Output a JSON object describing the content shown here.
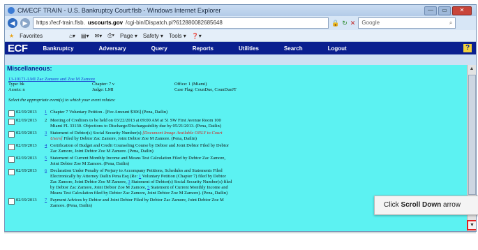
{
  "window": {
    "title": "CM/ECF TRAIN - U.S. Bankruptcy Court:flsb - Windows Internet Explorer",
    "buttons": {
      "minimize": "—",
      "maximize": "▭",
      "close": "✕"
    }
  },
  "addressbar": {
    "url_prefix": "https://ecf-train.flsb.",
    "url_domain": "uscourts.gov",
    "url_path": "/cgi-bin/Dispatch.pl?612880082685648",
    "search_placeholder": "Google",
    "icons": [
      "back-icon",
      "forward-icon",
      "lock-icon",
      "refresh-icon",
      "stop-icon",
      "search-icon"
    ]
  },
  "favbar": {
    "favorites": "Favorites",
    "page": "Page ▾",
    "safety": "Safety ▾",
    "tools": "Tools ▾",
    "help": "❓▾"
  },
  "ecf": {
    "logo": "ECF",
    "menu": [
      "Bankruptcy",
      "Adversary",
      "Query",
      "Reports",
      "Utilities",
      "Search",
      "Logout"
    ],
    "help_label": "?"
  },
  "page": {
    "section_title": "Miscellaneous:",
    "case_link": "13-10171-LMI Zac Zamore and Zoe M Zamore",
    "case_info": {
      "type": "Type: bk",
      "chapter": "Chapter: 7 v",
      "office": "Office: 1 (Miami)",
      "assets": "Assets: n",
      "judge": "Judge: LMI",
      "case_flag": "Case Flag: CounDue, CounDueJT"
    },
    "instructions": "Select the appropriate event(s) to which your event relates:",
    "entries": [
      {
        "date": "02/19/2013",
        "num": "1",
        "linked": true,
        "text": "Chapter 7 Voluntary Petition . [Fee Amount $306] (Pena, Dailin)"
      },
      {
        "date": "02/19/2013",
        "num": "2",
        "linked": false,
        "text": "Meeting of Creditors to be held on 03/22/2013 at 09:00 AM at 51 SW First Avenue Room 100 Miami FL 33130. Objections to Discharge/Dischargeability due by 05/21/2013. (Pena, Dailin)"
      },
      {
        "date": "02/19/2013",
        "num": "3",
        "linked": true,
        "text_a": "Statement of Debtor(s) Social Security Number(s) ",
        "text_red": "[Document Image Available ONLY to Court Users]",
        "text_b": " Filed by Debtor Zac Zamore, Joint Debtor Zoe M Zamore. (Pena, Dailin)"
      },
      {
        "date": "02/19/2013",
        "num": "4",
        "linked": true,
        "text": "Certification of Budget and Credit Counseling Course by Debtor and Joint Debtor Filed by Debtor Zac Zamore, Joint Debtor Zoe M Zamore. (Pena, Dailin)"
      },
      {
        "date": "02/19/2013",
        "num": "5",
        "linked": true,
        "text": "Statement of Current Monthly Income and Means Test Calculation Filed by Debtor Zac Zamore, Joint Debtor Zoe M Zamore. (Pena, Dailin)"
      },
      {
        "date": "02/19/2013",
        "num": "6",
        "linked": true,
        "text_a": "Declaration Under Penalty of Perjury to Accompany Petitions, Schedules and Statements Filed Electronically by Attorney Dailin Pena Esq (Re: ",
        "link1": "1",
        "text_b": " Voluntary Petition (Chapter 7) filed by Debtor Zac Zamore, Joint Debtor Zoe M Zamore, ",
        "link2": "3",
        "text_c": " Statement of Debtor(s) Social Security Number(s) filed by Debtor Zac Zamore, Joint Debtor Zoe M Zamore, ",
        "link3": "5",
        "text_d": " Statement of Current Monthly Income and Means Test Calculation filed by Debtor Zac Zamore, Joint Debtor Zoe M Zamore). (Pena, Dailin)"
      },
      {
        "date": "02/19/2013",
        "num": "7",
        "linked": true,
        "text": "Payment Advices by Debtor and Joint Debtor Filed by Debtor Zac Zamore, Joint Debtor Zoe M Zamore. (Pena, Dailin)"
      }
    ]
  },
  "tooltip": {
    "prefix": "Click ",
    "bold": "Scroll Down",
    "suffix": " arrow"
  },
  "colors": {
    "ecf_bar": "#0a1f8f",
    "content_bg": "#5cf2f2",
    "link": "#1a3bd0",
    "restricted": "#d42020",
    "highlight": "#e02020"
  }
}
